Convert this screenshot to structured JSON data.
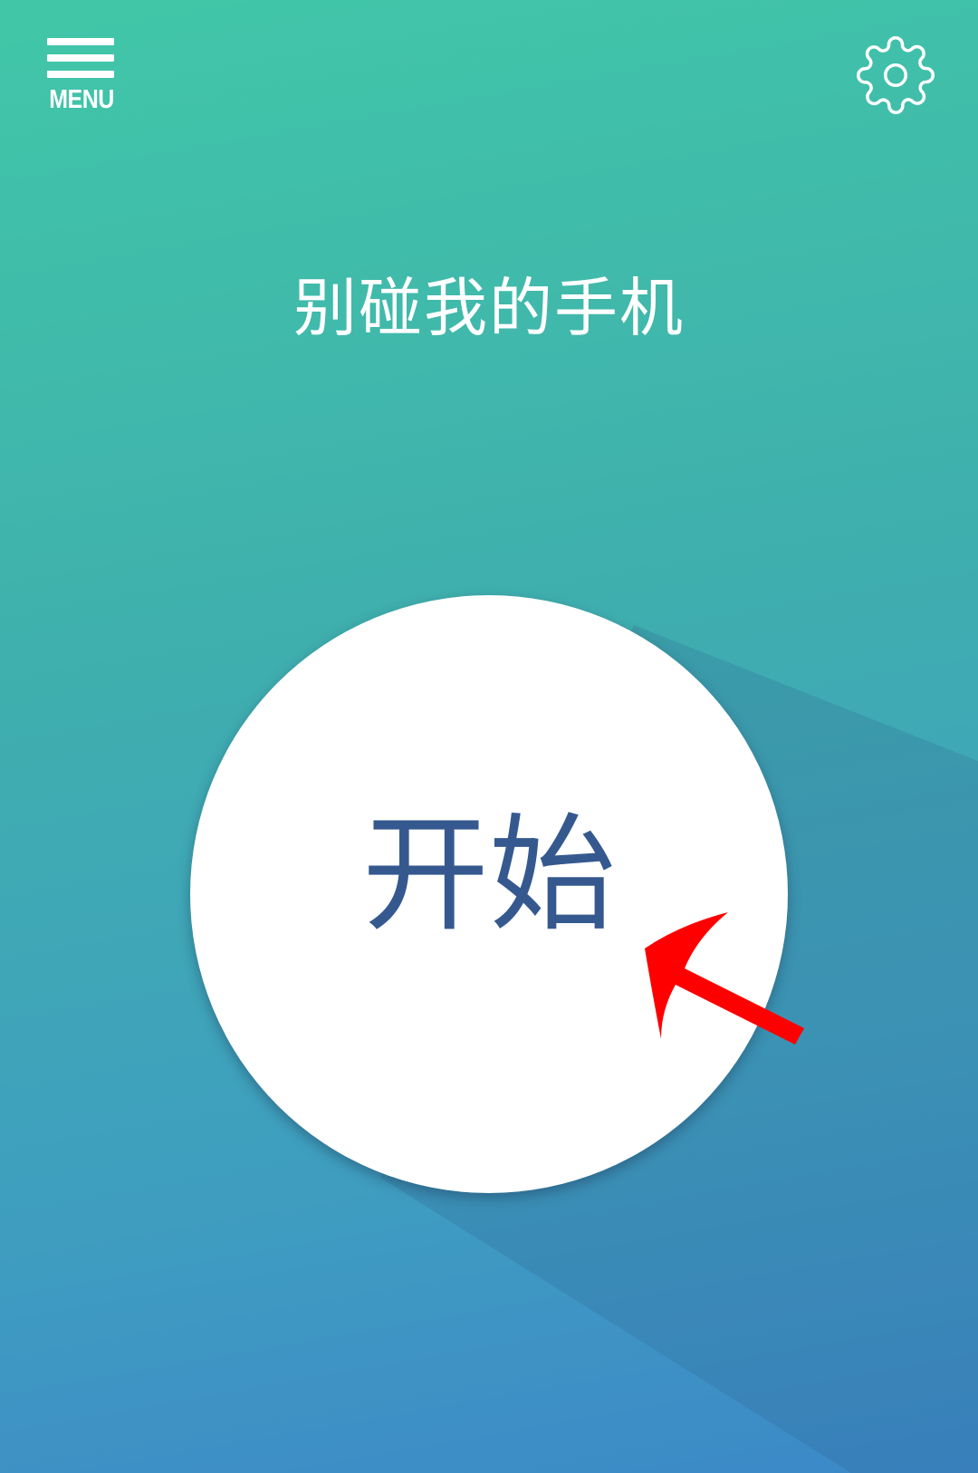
{
  "header": {
    "menu_label": "MENU",
    "menu_icon": "hamburger-icon",
    "settings_icon": "gear-icon"
  },
  "main": {
    "title": "别碰我的手机",
    "start_label": "开始"
  },
  "annotation": {
    "arrow_icon": "red-pointer-arrow",
    "arrow_color": "#ff0000"
  },
  "colors": {
    "gradient_top": "#41c7a8",
    "gradient_bottom": "#3c88c8",
    "button_text": "#35598f"
  }
}
